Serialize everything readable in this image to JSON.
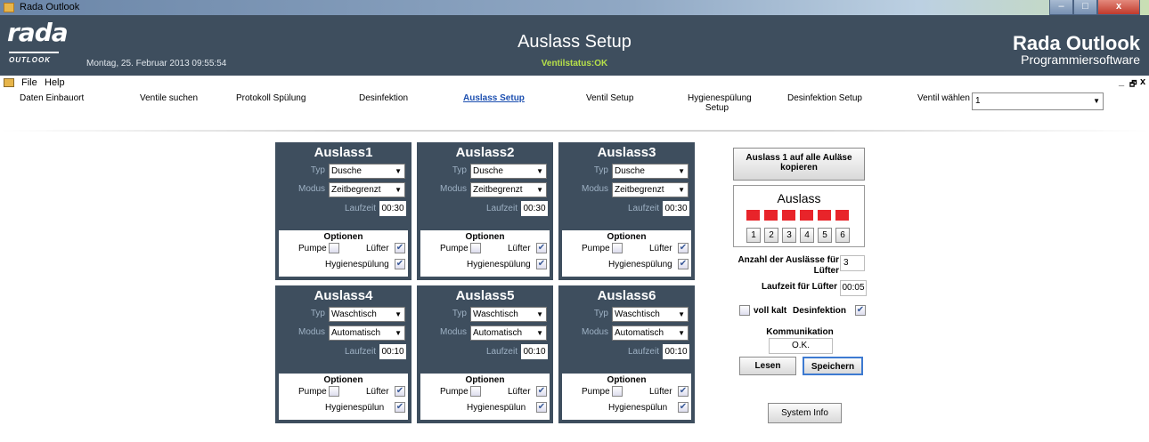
{
  "window": {
    "title": "Rada Outlook",
    "min": "–",
    "max": "□",
    "close": "x"
  },
  "header": {
    "logo_main": "rada",
    "logo_sub": "OUTLOOK",
    "datetime": "Montag, 25. Februar 2013 09:55:54",
    "title": "Auslass Setup",
    "status": "Ventilstatus:OK",
    "brand": "Rada Outlook",
    "brand_sub": "Programmiersoftware"
  },
  "menu": {
    "file": "File",
    "help": "Help",
    "mdi_min": "_",
    "mdi_restore": "🗗",
    "mdi_close": "x"
  },
  "nav": {
    "items": [
      "Daten Einbauort",
      "Ventile suchen",
      "Protokoll Spülung",
      "Desinfektion",
      "Auslass Setup",
      "Ventil Setup",
      "Hygienespülung Setup",
      "Desinfektion Setup"
    ],
    "active": "Auslass Setup",
    "ventil_label": "Ventil wählen",
    "ventil_value": "1"
  },
  "labels": {
    "typ": "Typ",
    "modus": "Modus",
    "laufzeit": "Laufzeit",
    "optionen": "Optionen",
    "pumpe": "Pumpe",
    "luefter": "Lüfter"
  },
  "outlets": [
    {
      "name": "Auslass1",
      "typ": "Dusche",
      "modus": "Zeitbegrenzt",
      "laufzeit": "00:30",
      "pumpe": false,
      "luefter": true,
      "hygiene_label": "Hygienespülung",
      "hygiene": true
    },
    {
      "name": "Auslass2",
      "typ": "Dusche",
      "modus": "Zeitbegrenzt",
      "laufzeit": "00:30",
      "pumpe": false,
      "luefter": true,
      "hygiene_label": "Hygienespülung",
      "hygiene": true
    },
    {
      "name": "Auslass3",
      "typ": "Dusche",
      "modus": "Zeitbegrenzt",
      "laufzeit": "00:30",
      "pumpe": false,
      "luefter": true,
      "hygiene_label": "Hygienespülung",
      "hygiene": true
    },
    {
      "name": "Auslass4",
      "typ": "Waschtisch",
      "modus": "Automatisch",
      "laufzeit": "00:10",
      "pumpe": false,
      "luefter": true,
      "hygiene_label": "Hygienespülun",
      "hygiene": true
    },
    {
      "name": "Auslass5",
      "typ": "Waschtisch",
      "modus": "Automatisch",
      "laufzeit": "00:10",
      "pumpe": false,
      "luefter": true,
      "hygiene_label": "Hygienespülun",
      "hygiene": true
    },
    {
      "name": "Auslass6",
      "typ": "Waschtisch",
      "modus": "Automatisch",
      "laufzeit": "00:10",
      "pumpe": false,
      "luefter": true,
      "hygiene_label": "Hygienespülun",
      "hygiene": true
    }
  ],
  "right": {
    "copy_button": "Auslass 1 auf alle Auläse kopieren",
    "auslass_title": "Auslass",
    "auslass_numbers": [
      "1",
      "2",
      "3",
      "4",
      "5",
      "6"
    ],
    "anzahl_label": "Anzahl der Auslässe für Lüfter",
    "anzahl_value": "3",
    "laufzeit_label": "Laufzeit für Lüfter",
    "laufzeit_value": "00:05",
    "voll_kalt": "voll kalt",
    "desinfektion": "Desinfektion",
    "kommunikation": "Kommunikation",
    "kommunikation_value": "O.K.",
    "lesen": "Lesen",
    "speichern": "Speichern",
    "system_info": "System Info"
  },
  "colors": {
    "panel": "#3e4e5e",
    "status": "#b7e04a",
    "lamp": "#e8242a",
    "active_nav": "#1c4fb0"
  }
}
